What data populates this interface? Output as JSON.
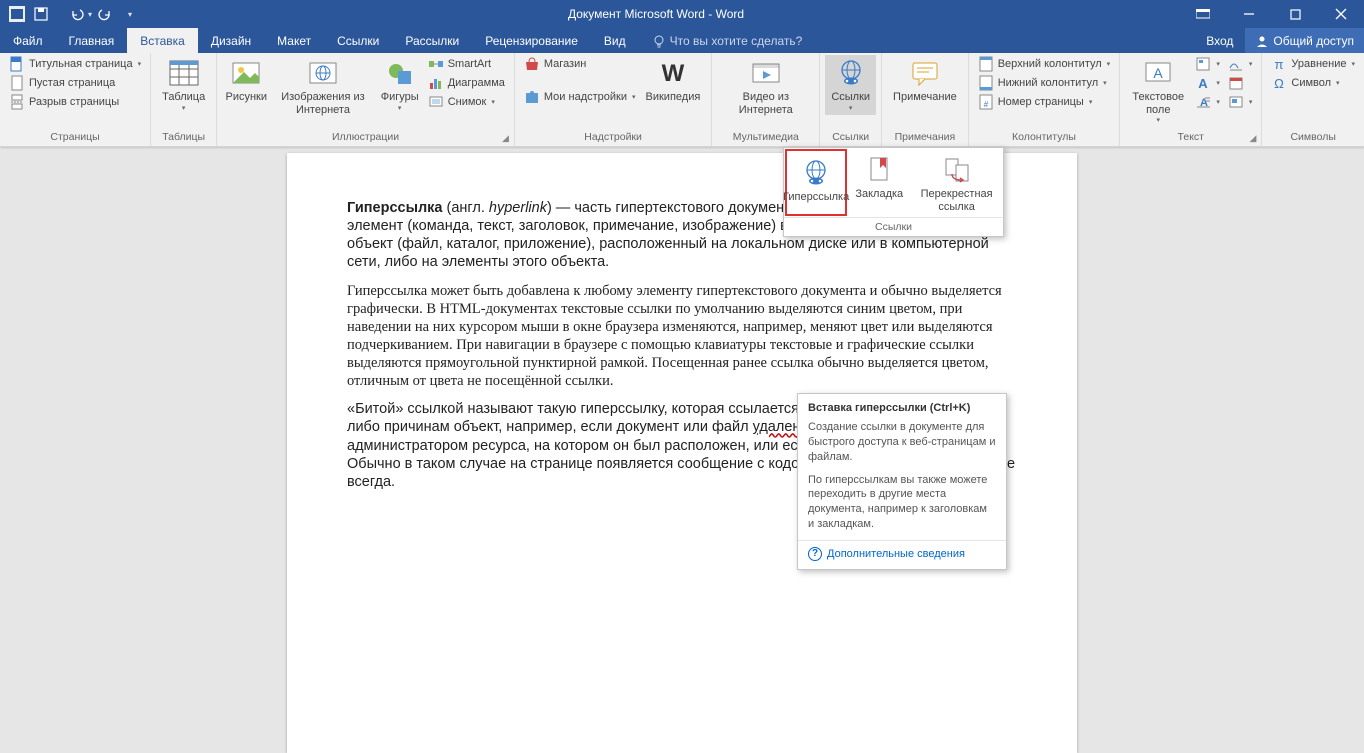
{
  "titlebar": {
    "title": "Документ Microsoft Word - Word"
  },
  "menubar": {
    "file": "Файл",
    "tabs": [
      "Главная",
      "Вставка",
      "Дизайн",
      "Макет",
      "Ссылки",
      "Рассылки",
      "Рецензирование",
      "Вид"
    ],
    "active": 1,
    "tell": "Что вы хотите сделать?",
    "login": "Вход",
    "share": "Общий доступ"
  },
  "ribbon": {
    "pages": {
      "label": "Страницы",
      "cover": "Титульная страница",
      "blank": "Пустая страница",
      "break": "Разрыв страницы"
    },
    "tables": {
      "label": "Таблицы",
      "table": "Таблица"
    },
    "illus": {
      "label": "Иллюстрации",
      "pictures": "Рисунки",
      "online": "Изображения из Интернета",
      "shapes": "Фигуры",
      "smartart": "SmartArt",
      "chart": "Диаграмма",
      "screenshot": "Снимок"
    },
    "addins": {
      "label": "Надстройки",
      "store": "Магазин",
      "myaddins": "Мои надстройки",
      "wiki": "Википедия"
    },
    "media": {
      "label": "Мультимедиа",
      "video": "Видео из Интернета"
    },
    "links": {
      "label": "Ссылки",
      "links": "Ссылки"
    },
    "comments": {
      "label": "Примечания",
      "comment": "Примечание"
    },
    "headerfooter": {
      "label": "Колонтитулы",
      "header": "Верхний колонтитул",
      "footer": "Нижний колонтитул",
      "pagenum": "Номер страницы"
    },
    "text": {
      "label": "Текст",
      "textbox": "Текстовое поле"
    },
    "symbols": {
      "label": "Символы",
      "equation": "Уравнение",
      "symbol": "Символ"
    }
  },
  "dropdown": {
    "hyperlink": "Гиперссылка",
    "bookmark": "Закладка",
    "crossref": "Перекрестная ссылка",
    "label": "Ссылки"
  },
  "tooltip": {
    "title": "Вставка гиперссылки (Ctrl+K)",
    "p1": "Создание ссылки в документе для быстрого доступа к веб-страницам и файлам.",
    "p2": "По гиперссылкам вы также можете переходить в другие места документа, например к заголовкам и закладкам.",
    "more": "Дополнительные сведения"
  },
  "doc": {
    "p1a": "Гиперссылка",
    "p1b": " (англ. ",
    "p1c": "hyperlink",
    "p1d": ") — часть гипертекстового документа, ссылающаяся на другой элемент (команда, текст, заголовок, примечание, изображение) в самом документе, на другой объект (файл, каталог, приложение), расположенный на локальном диске или в компьютерной сети, либо на элементы этого объекта.",
    "p2": "Гиперссылка может быть добавлена к любому элементу гипертекстового документа и обычно выделяется графически. В HTML-документах текстовые ссылки по умолчанию выделяются синим цветом, при наведении на них курсором мыши в окне браузера изменяются, например, меняют цвет или выделяются подчеркиванием. При навигации в браузере с помощью клавиатуры текстовые и графические ссылки выделяются прямоугольной пунктирной рамкой. Посещенная ранее ссылка обычно выделяется цветом, отличным от цвета не посещённой ссылки.",
    "p3a": "«Битой» ссылкой называют такую гиперссылку, которая ссылается на отсутствующий по каким-либо причинам объект, например, если документ или файл ",
    "p3b": "удален",
    "p3c": " или перемещен администратором ресурса, на котором он был расположен, или если сам ресурс недоступен. Обычно в таком случае на странице появляется сообщение с кодом ошибки, но это происходит не всегда."
  }
}
